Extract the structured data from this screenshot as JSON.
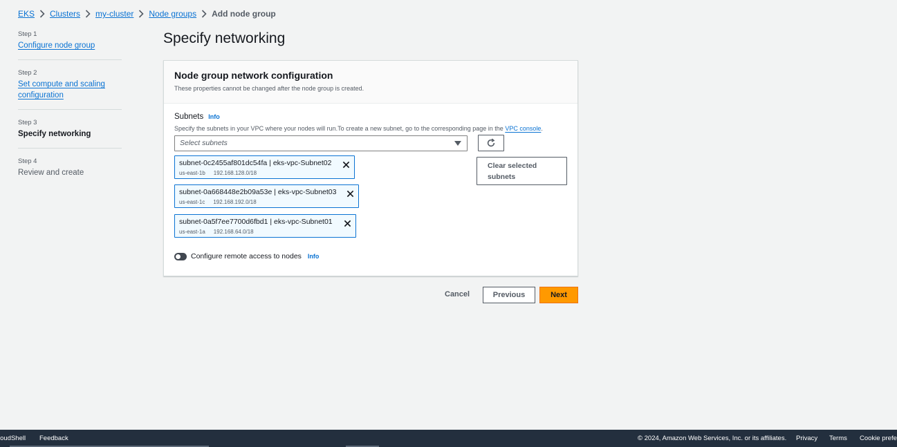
{
  "breadcrumb": {
    "items": [
      "EKS",
      "Clusters",
      "my-cluster",
      "Node groups"
    ],
    "current": "Add node group"
  },
  "steps": [
    {
      "num": "Step 1",
      "title": "Configure node group",
      "state": "link"
    },
    {
      "num": "Step 2",
      "title": "Set compute and scaling configuration",
      "state": "link"
    },
    {
      "num": "Step 3",
      "title": "Specify networking",
      "state": "active"
    },
    {
      "num": "Step 4",
      "title": "Review and create",
      "state": "inactive"
    }
  ],
  "page": {
    "title": "Specify networking"
  },
  "container": {
    "title": "Node group network configuration",
    "description": "These properties cannot be changed after the node group is created."
  },
  "subnets": {
    "label": "Subnets",
    "info": "Info",
    "description": "Specify the subnets in your VPC where your nodes will run.To create a new subnet, go to the corresponding page in the",
    "vpc_link": "VPC console",
    "description_end": ".",
    "placeholder": "Select subnets",
    "clear_label": "Clear selected subnets",
    "tokens": [
      {
        "name": "subnet-0c2455af801dc54fa | eks-vpc-Subnet02",
        "az": "us-east-1b",
        "cidr": "192.168.128.0/18"
      },
      {
        "name": "subnet-0a668448e2b09a53e | eks-vpc-Subnet03",
        "az": "us-east-1c",
        "cidr": "192.168.192.0/18"
      },
      {
        "name": "subnet-0a5f7ee7700d6fbd1 | eks-vpc-Subnet01",
        "az": "us-east-1a",
        "cidr": "192.168.64.0/18"
      }
    ]
  },
  "remote_access": {
    "label": "Configure remote access to nodes",
    "info": "Info",
    "enabled": false
  },
  "actions": {
    "cancel": "Cancel",
    "previous": "Previous",
    "next": "Next"
  },
  "footer": {
    "cloudshell": "loudShell",
    "feedback": "Feedback",
    "copyright": "© 2024, Amazon Web Services, Inc. or its affiliates.",
    "privacy": "Privacy",
    "terms": "Terms",
    "cookie": "Cookie prefer"
  },
  "colors": {
    "accent": "#0972d3",
    "primary_button": "#ff9900",
    "footer_bg": "#232f3e",
    "page_bg": "#f2f3f3"
  }
}
